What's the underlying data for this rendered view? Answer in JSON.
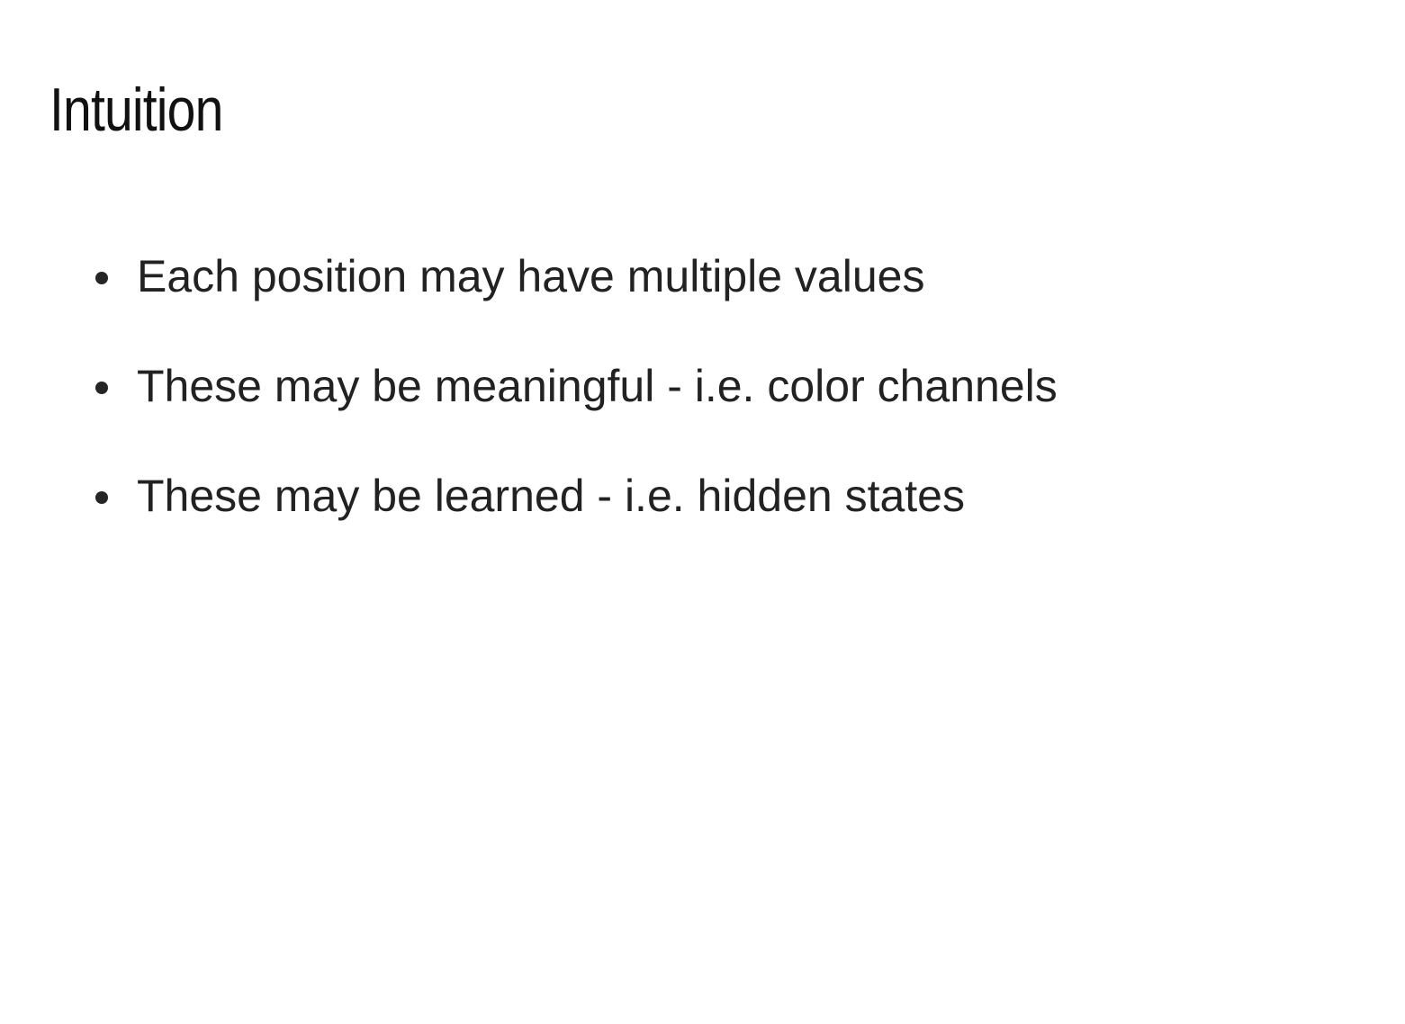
{
  "slide": {
    "title": "Intuition",
    "bullets": [
      {
        "text": "Each position may have multiple values"
      },
      {
        "text": "These may be meaningful - i.e. color channels"
      },
      {
        "text": "These may be learned - i.e. hidden states"
      }
    ]
  },
  "colors": {
    "background": "#ffffff",
    "title": "#111111",
    "body_text": "#222222",
    "bullet": "#262626"
  }
}
